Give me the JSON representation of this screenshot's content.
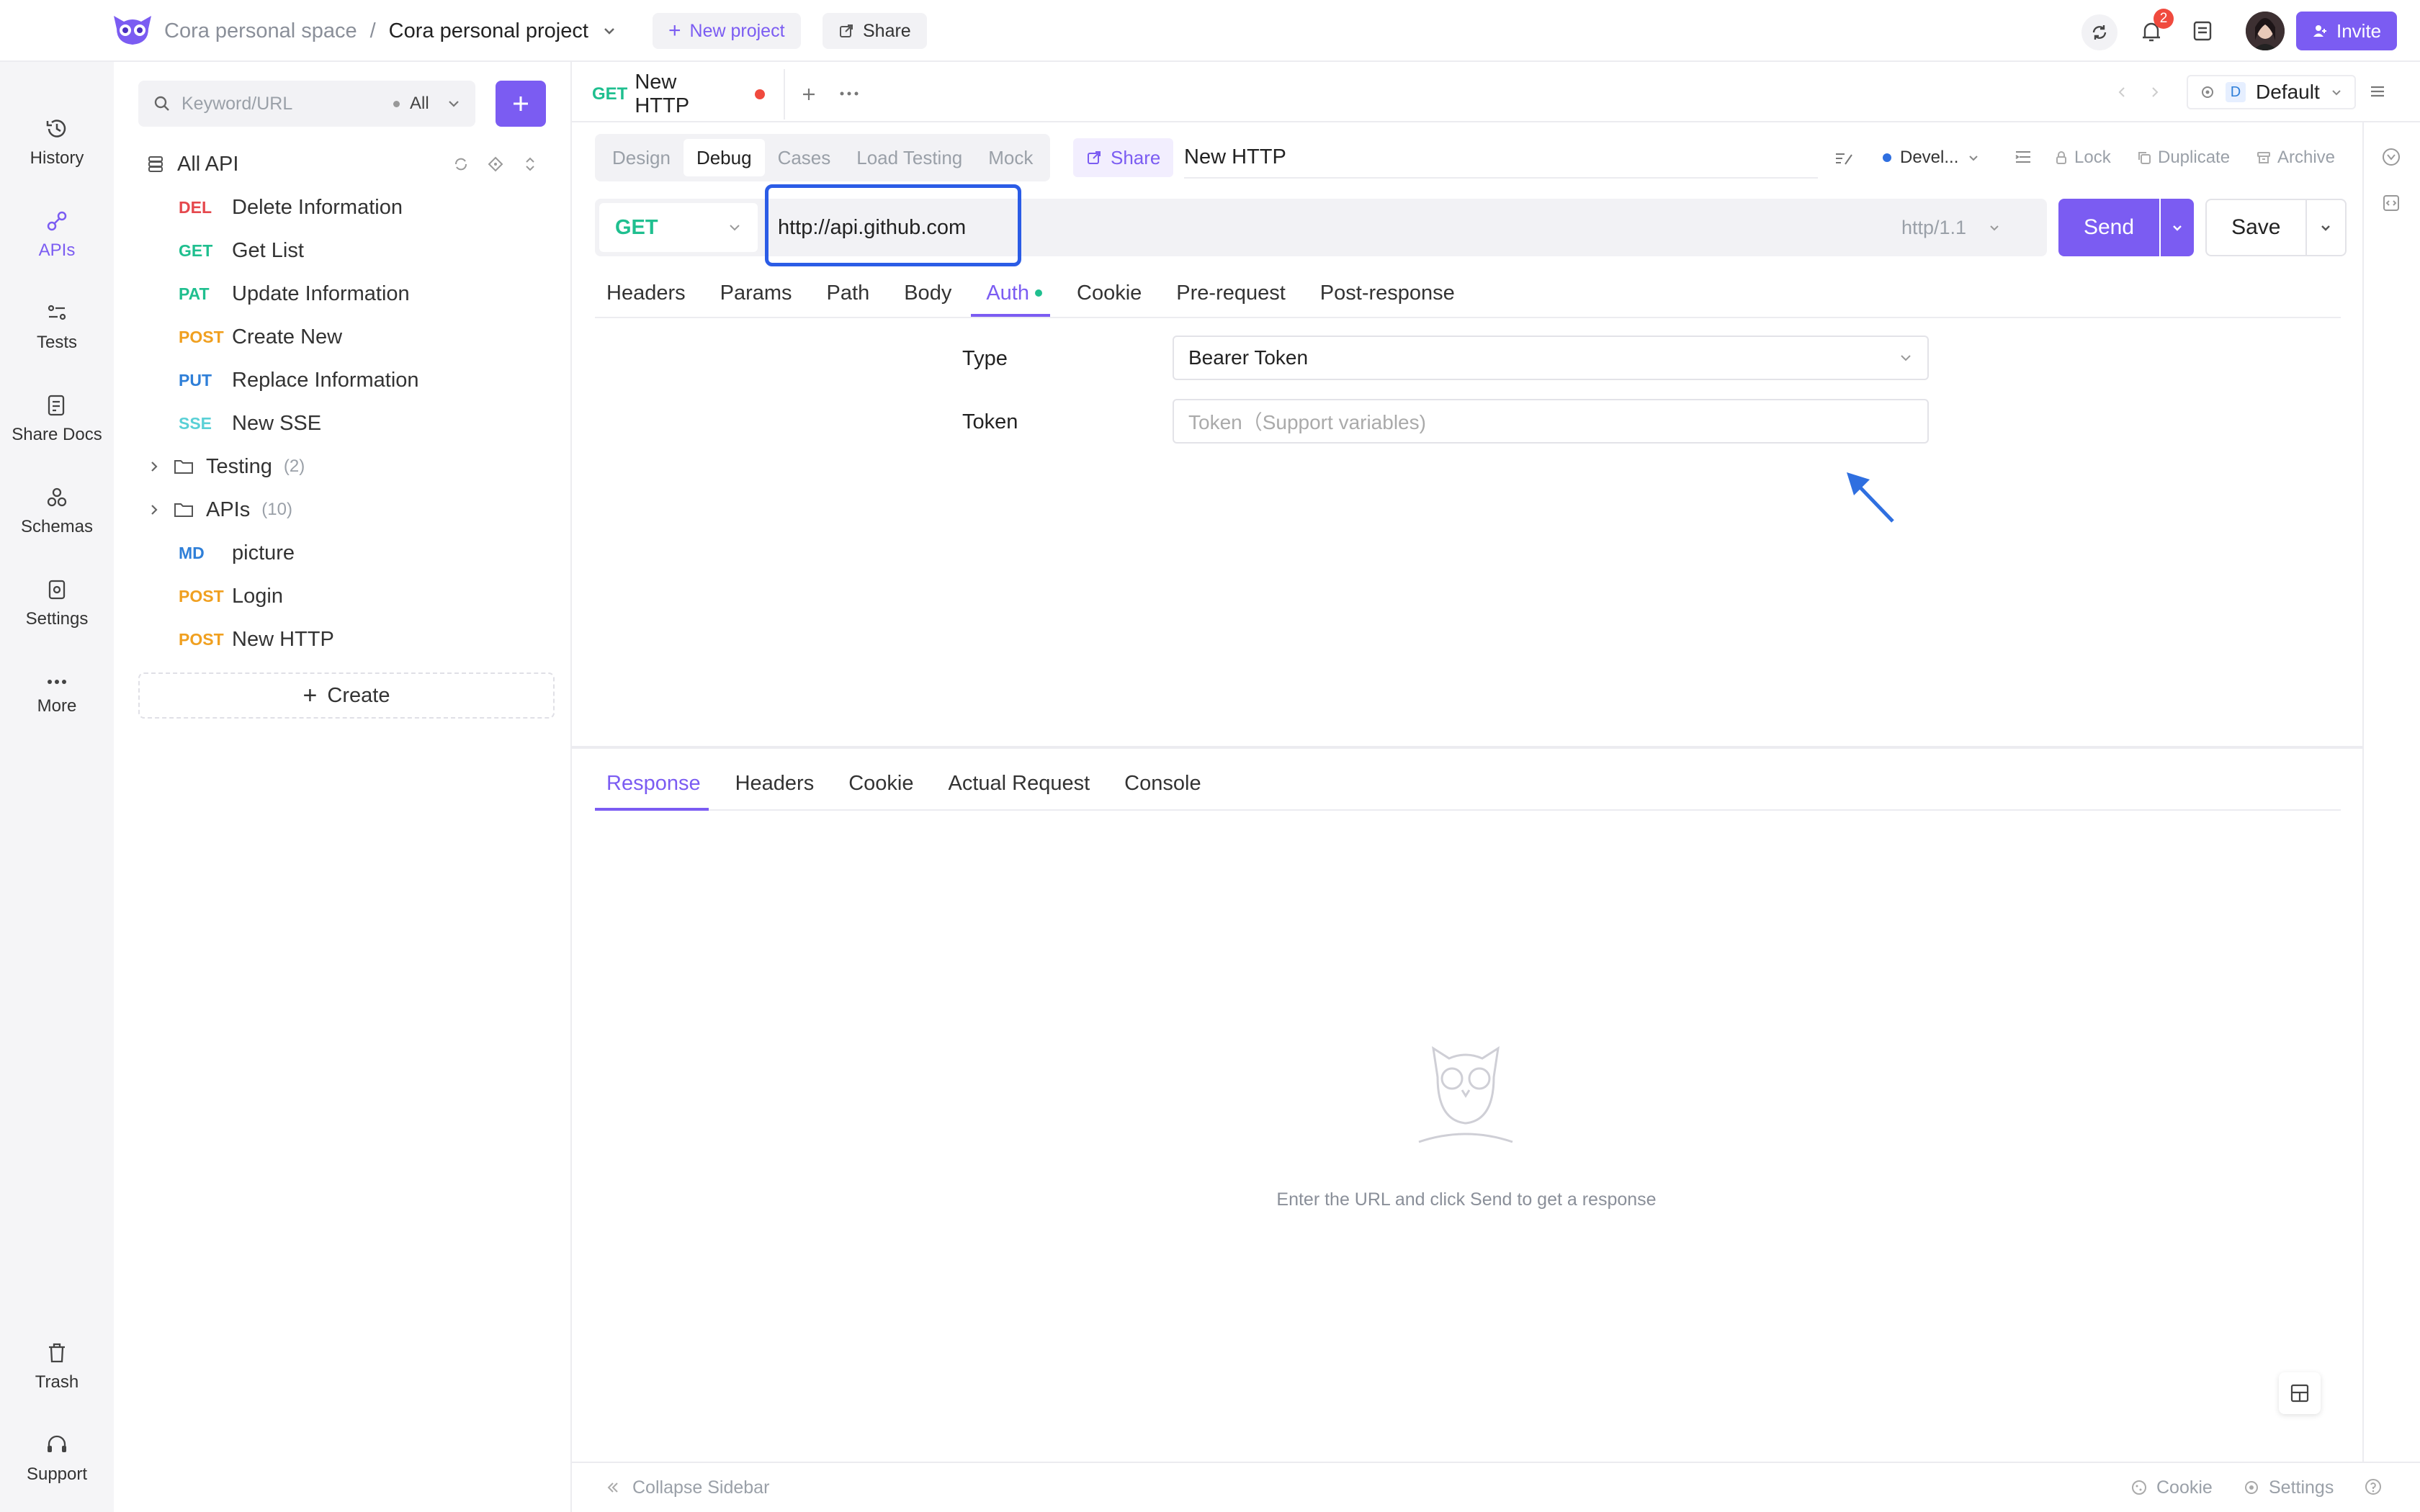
{
  "topbar": {
    "space": "Cora personal space",
    "separator": "/",
    "project": "Cora personal project",
    "new_project": "New project",
    "share": "Share",
    "notifications_count": "2",
    "invite": "Invite"
  },
  "rail": {
    "items": [
      "History",
      "APIs",
      "Tests",
      "Share Docs",
      "Schemas",
      "Settings",
      "More"
    ],
    "trash": "Trash",
    "support": "Support"
  },
  "sidebar": {
    "search_placeholder": "Keyword/URL",
    "filter": "All",
    "all_api": "All API",
    "items": [
      {
        "method": "DEL",
        "color": "#e5484d",
        "label": "Delete Information"
      },
      {
        "method": "GET",
        "color": "#1fbf8f",
        "label": "Get List"
      },
      {
        "method": "PAT",
        "color": "#1fbf8f",
        "label": "Update Information"
      },
      {
        "method": "POST",
        "color": "#f0a020",
        "label": "Create New"
      },
      {
        "method": "PUT",
        "color": "#2f7fd8",
        "label": "Replace Information"
      },
      {
        "method": "SSE",
        "color": "#5ad0d6",
        "label": "New SSE"
      }
    ],
    "folders": [
      {
        "label": "Testing",
        "count": "(2)"
      },
      {
        "label": "APIs",
        "count": "(10)"
      }
    ],
    "items2": [
      {
        "method": "MD",
        "color": "#2f7fd8",
        "label": "picture"
      },
      {
        "method": "POST",
        "color": "#f0a020",
        "label": "Login"
      },
      {
        "method": "POST",
        "color": "#f0a020",
        "label": "New HTTP"
      }
    ],
    "create": "Create"
  },
  "tabbar": {
    "method": "GET",
    "title": "New HTTP",
    "env_badge": "D",
    "env": "Default"
  },
  "toolbar": {
    "tabs": [
      "Design",
      "Debug",
      "Cases",
      "Load Testing",
      "Mock"
    ],
    "active_tab": "Debug",
    "share": "Share",
    "name": "New HTTP",
    "status": "Devel...",
    "lock": "Lock",
    "duplicate": "Duplicate",
    "archive": "Archive"
  },
  "request": {
    "method": "GET",
    "url": "http://api.github.com",
    "protocol": "http/1.1",
    "send": "Send",
    "save": "Save"
  },
  "req_tabs": [
    "Headers",
    "Params",
    "Path",
    "Body",
    "Auth",
    "Cookie",
    "Pre-request",
    "Post-response"
  ],
  "auth": {
    "type_label": "Type",
    "type_value": "Bearer Token",
    "token_label": "Token",
    "token_placeholder": "Token（Support variables)"
  },
  "resp_tabs": [
    "Response",
    "Headers",
    "Cookie",
    "Actual Request",
    "Console"
  ],
  "response": {
    "empty_text": "Enter the URL and click Send to get a response"
  },
  "footer": {
    "collapse": "Collapse Sidebar",
    "cookie": "Cookie",
    "settings": "Settings"
  },
  "colors": {
    "accent": "#7b5cf2",
    "highlight_box": "#2b5ce6",
    "arrow": "#2f6fe0"
  }
}
